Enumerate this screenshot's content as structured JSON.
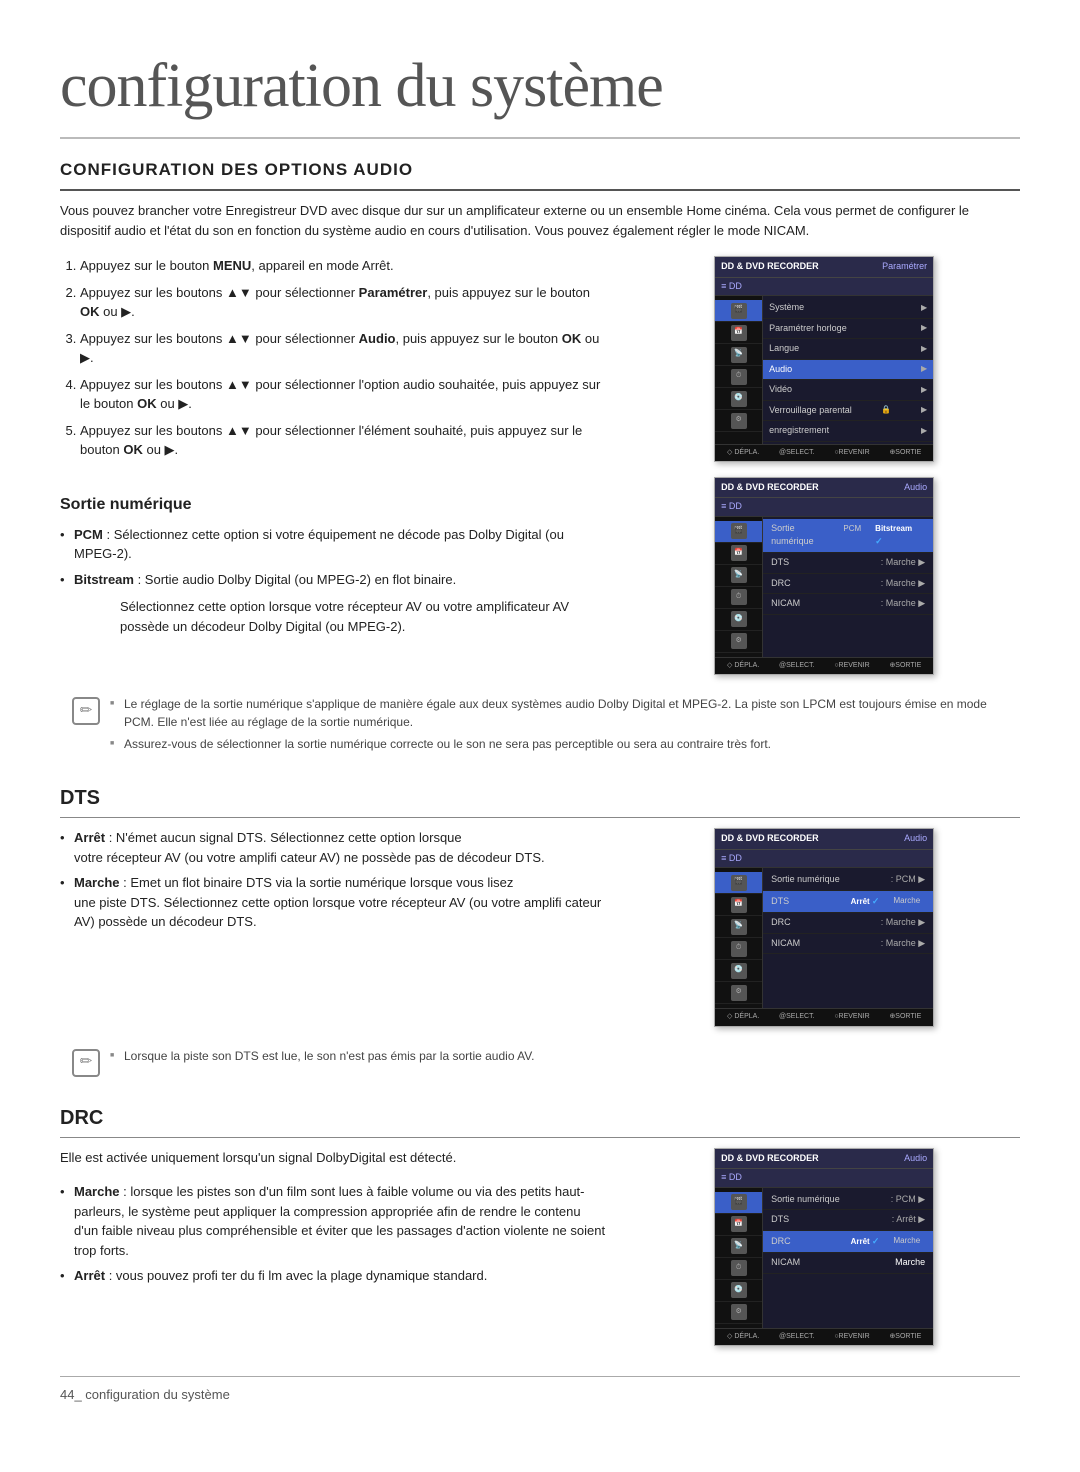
{
  "page": {
    "title": "configuration du système",
    "section_title": "CONFIGURATION DES OPTIONS AUDIO",
    "intro": "Vous pouvez brancher votre Enregistreur DVD avec disque dur sur un amplificateur externe ou un ensemble Home cinéma. Cela vous permet de configurer le dispositif audio et l'état du son en fonction du système audio en cours d'utilisation. Vous pouvez également régler le mode NICAM.",
    "steps": [
      {
        "num": "1",
        "text": "Appuyez sur le bouton MENU, appareil en mode Arrêt."
      },
      {
        "num": "2",
        "text": "Appuyez sur les boutons ▲▼ pour sélectionner Paramétrer, puis appuyez sur le bouton OK ou ▶."
      },
      {
        "num": "3",
        "text": "Appuyez sur les boutons ▲▼ pour sélectionner Audio, puis appuyez sur le bouton OK ou ▶."
      },
      {
        "num": "4",
        "text": "Appuyez sur les boutons ▲▼ pour sélectionner l'option audio souhaitée, puis appuyez sur le bouton OK ou ▶."
      },
      {
        "num": "5",
        "text": "Appuyez sur les boutons ▲▼ pour sélectionner l'élément souhaité, puis appuyez sur le bouton OK ou ▶."
      }
    ],
    "menu1": {
      "header_left": "DD & DVD RECORDER",
      "header_right": "Paramétrer",
      "dd_label": "DD",
      "sidebar_items": [
        "Bibliothèque",
        "Guide",
        "Canal",
        "Em.parmi.",
        "Conf. en Disque",
        "Paramètre"
      ],
      "menu_items": [
        {
          "label": "Système",
          "has_arrow": true
        },
        {
          "label": "Paramétrer horloge",
          "has_arrow": true
        },
        {
          "label": "Langue",
          "has_arrow": true
        },
        {
          "label": "Audio",
          "has_arrow": true,
          "highlighted": true
        },
        {
          "label": "Vidéo",
          "has_arrow": true
        },
        {
          "label": "Verrouillage parental",
          "has_arrow": true
        },
        {
          "label": "enregistrement",
          "has_arrow": true
        }
      ],
      "footer": [
        "◇ DÉPLA.",
        "@SELECT.",
        "○REVENIR",
        "⊕SORTIE"
      ]
    },
    "sortie_numerique": {
      "subsection_title": "Sortie numérique",
      "bullets": [
        {
          "keyword": "PCM",
          "text": " : Sélectionnez cette option si votre équipement ne décode pas Dolby Digital (ou MPEG-2)."
        },
        {
          "keyword": "Bitstream",
          "text": " : Sortie audio Dolby Digital (ou MPEG-2) en flot binaire."
        }
      ],
      "bitstream_indent": "Sélectionnez cette option lorsque votre récepteur AV ou votre amplificateur AV possède un décodeur Dolby Digital (ou MPEG-2).",
      "menu2": {
        "header_left": "DD & DVD RECORDER",
        "header_right": "Audio",
        "audio_rows": [
          {
            "label": "Sortie numérique",
            "options": [
              "PCM",
              "Bitstream"
            ],
            "active": "Bitstream"
          },
          {
            "label": "DTS",
            "options": [
              "Marche"
            ],
            "active": "Marche",
            "has_arrow": true
          },
          {
            "label": "DRC",
            "options": [
              "Marche"
            ],
            "active": "Marche",
            "has_arrow": true
          },
          {
            "label": "NICAM",
            "options": [
              "Marche"
            ],
            "active": "Marche",
            "has_arrow": true
          }
        ]
      }
    },
    "note1": {
      "lines": [
        "Le réglage de la sortie numérique s'applique de manière égale aux deux systèmes audio Dolby Digital et MPEG-2. La piste son LPCM est toujours émise en mode PCM. Elle n'est liée au réglage de la sortie numérique.",
        "Assurez-vous de sélectionner la sortie numérique correcte ou le son ne sera pas perceptible ou sera au contraire très fort."
      ]
    },
    "dts": {
      "title": "DTS",
      "bullets": [
        {
          "keyword": "Arrêt",
          "text": " : N'émet aucun signal DTS. Sélectionnez cette option lorsque votre récepteur AV (ou votre amplifi cateur AV) ne possède pas de décodeur DTS."
        },
        {
          "keyword": "Marche",
          "text": " : Emet un flot binaire DTS via la sortie numérique lorsque vous lisez une piste DTS. Sélectionnez cette option lorsque votre récepteur AV (ou votre amplifi cateur AV) possède un décodeur DTS."
        }
      ],
      "note": "Lorsque la piste son DTS est lue, le son n'est pas émis par la sortie audio AV.",
      "menu3": {
        "header_left": "DD & DVD RECORDER",
        "header_right": "Audio",
        "audio_rows": [
          {
            "label": "Sortie numérique",
            "value": ": PCM",
            "has_arrow": true
          },
          {
            "label": "DTS",
            "options": [
              "Arrêt",
              "Marche"
            ],
            "active": "Arrêt"
          },
          {
            "label": "DRC",
            "value": ": Marche",
            "has_arrow": true
          },
          {
            "label": "NICAM",
            "value": ": Marche",
            "has_arrow": true
          }
        ]
      }
    },
    "drc": {
      "title": "DRC",
      "intro": "Elle est activée uniquement lorsqu'un signal DolbyDigital est détecté.",
      "bullets": [
        {
          "keyword": "Marche",
          "text": " : lorsque les pistes son d'un film sont lues à faible volume ou via des petits haut-parleurs, le système peut appliquer la compression appropriée afin de rendre le contenu d'un faible niveau plus compréhensible et éviter que les passages d'action violente ne soient trop forts."
        },
        {
          "keyword": "Arrêt",
          "text": " : vous pouvez profi ter du fi lm avec la plage dynamique standard."
        }
      ],
      "menu4": {
        "header_left": "DD & DVD RECORDER",
        "header_right": "Audio",
        "audio_rows": [
          {
            "label": "Sortie numérique",
            "value": ": PCM",
            "has_arrow": true
          },
          {
            "label": "DTS",
            "value": ": Arrêt",
            "has_arrow": true
          },
          {
            "label": "DRC",
            "options": [
              "Arrêt",
              "Marche"
            ],
            "active": "Arrêt"
          },
          {
            "label": "NICAM",
            "value": "Marche"
          }
        ]
      }
    },
    "footer_label": "44_ configuration du système"
  }
}
